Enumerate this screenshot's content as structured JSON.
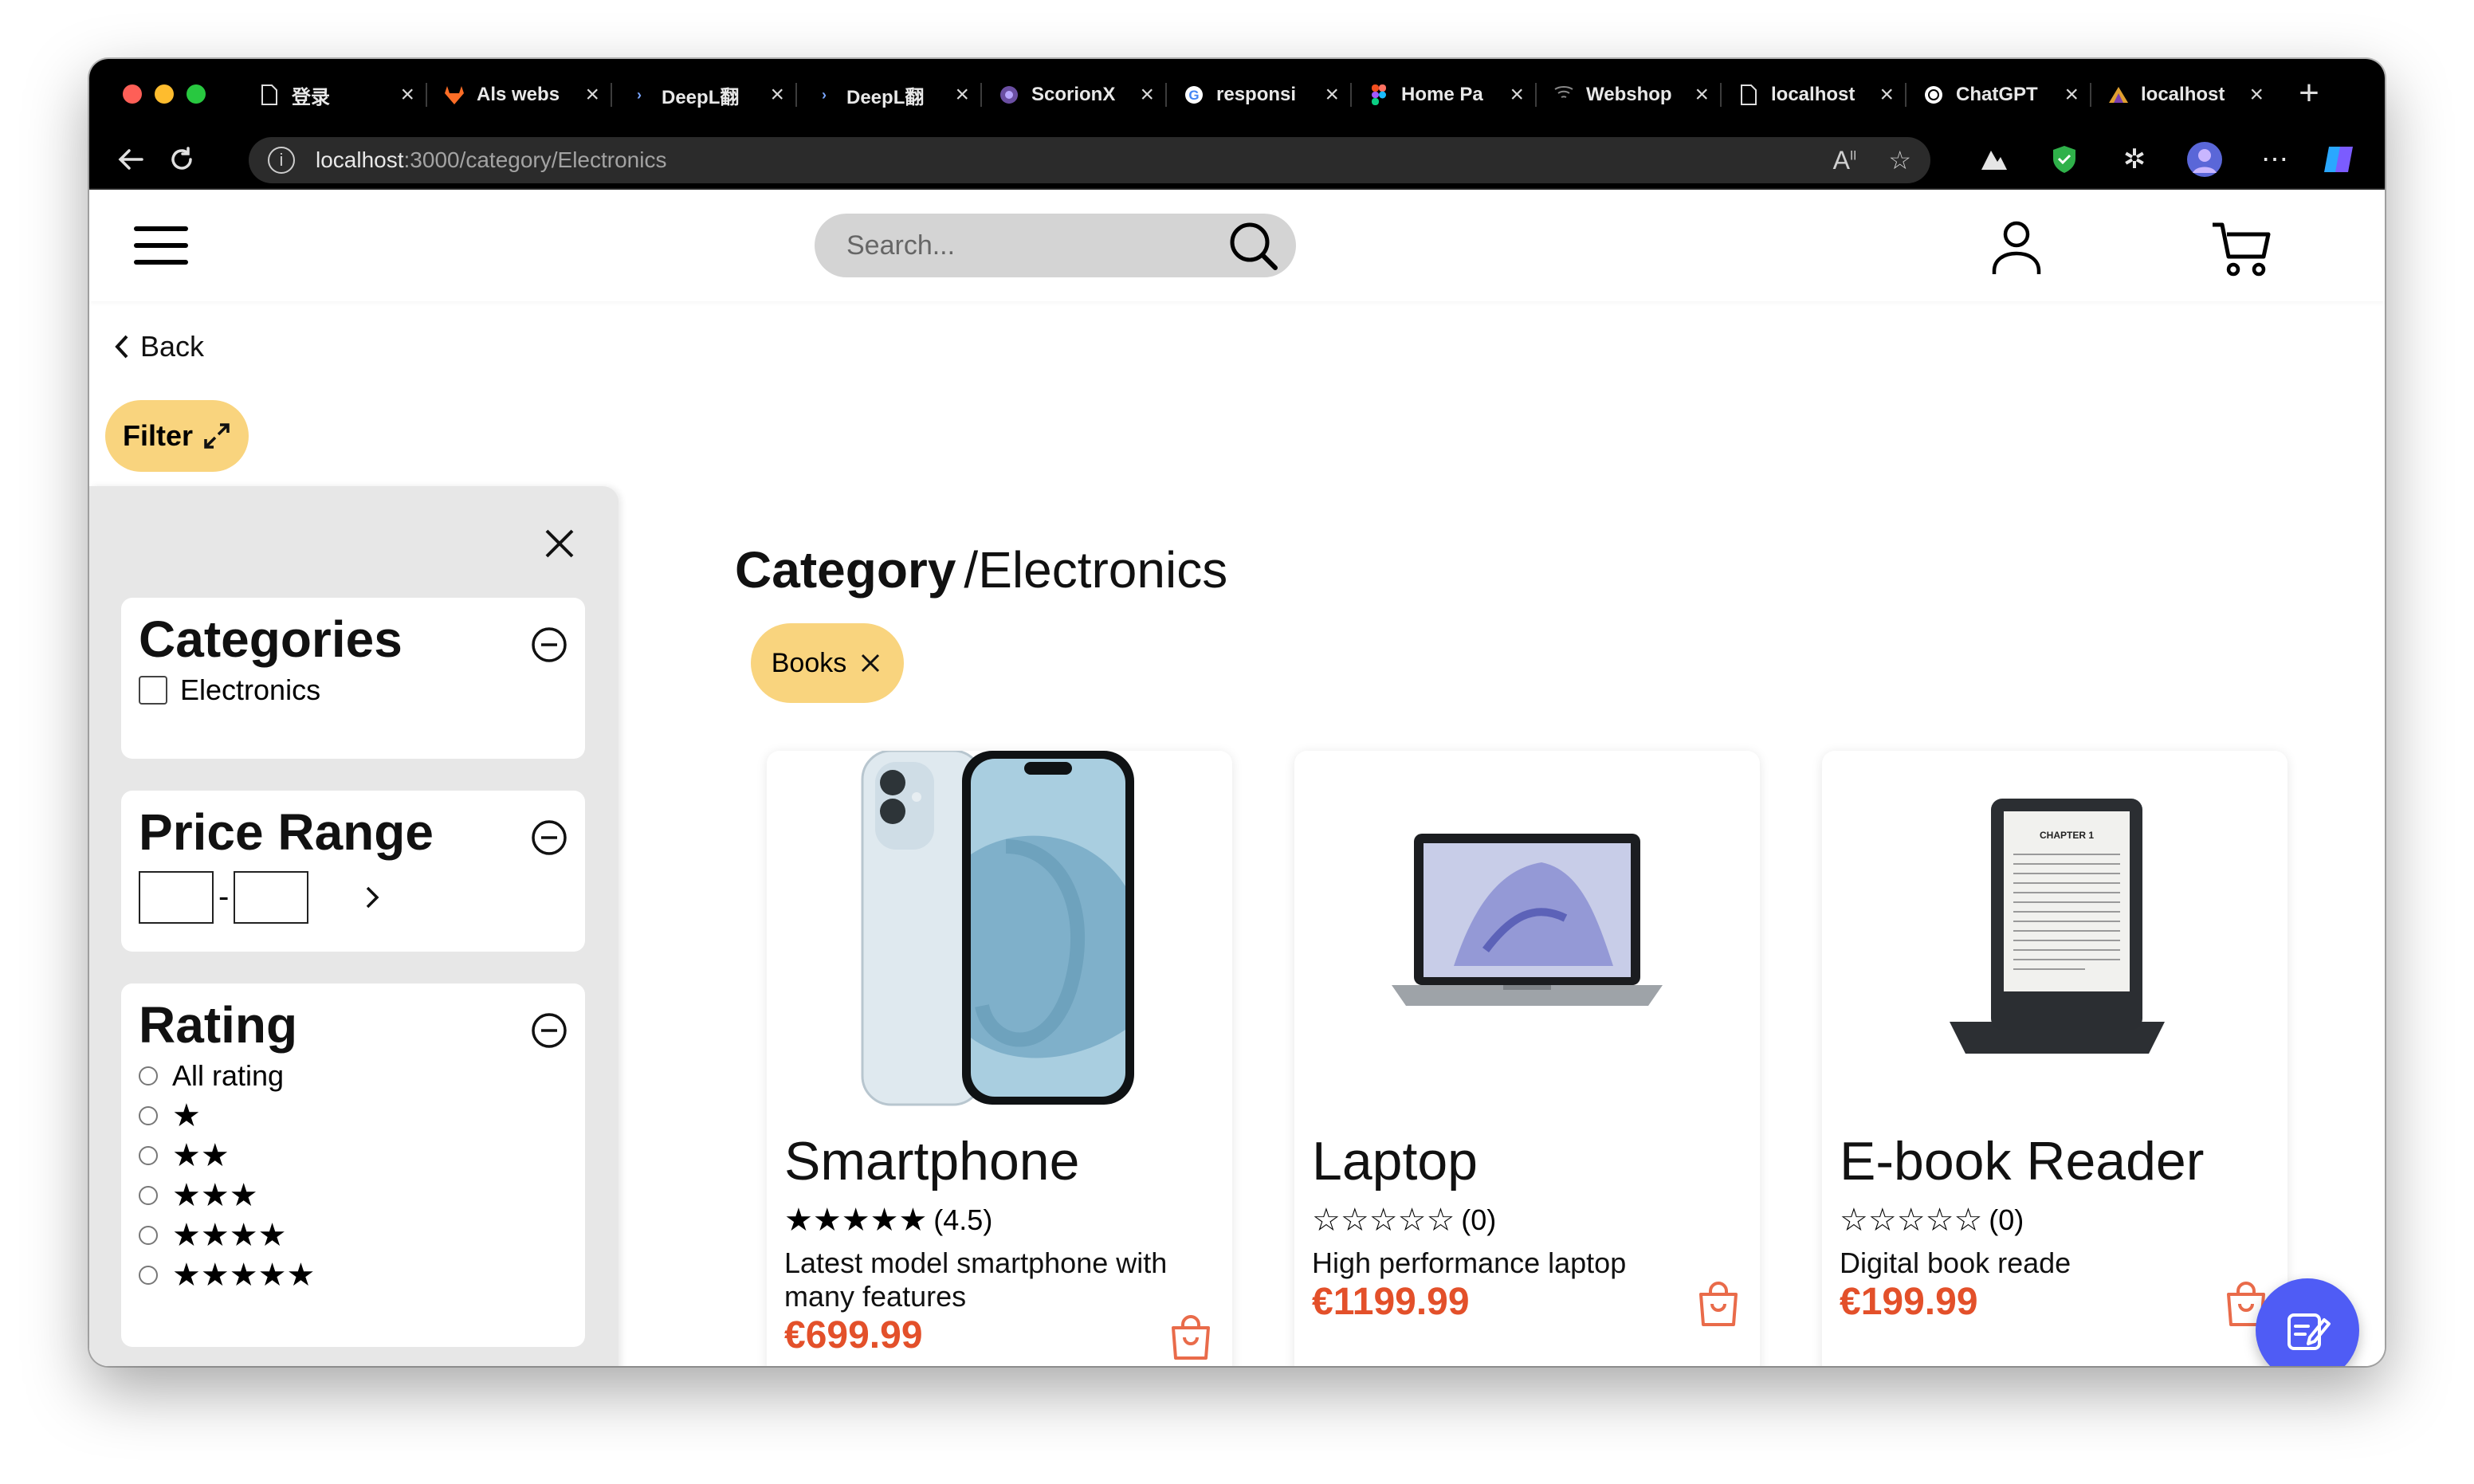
{
  "browser": {
    "tabs": [
      {
        "title": "登录",
        "favicon": "document-icon"
      },
      {
        "title": "Als webs",
        "favicon": "gitlab-icon"
      },
      {
        "title": "DeepL翻",
        "favicon": "deepl-icon"
      },
      {
        "title": "DeepL翻",
        "favicon": "deepl-icon"
      },
      {
        "title": "ScorionX",
        "favicon": "scorion-icon"
      },
      {
        "title": "responsi",
        "favicon": "google-icon"
      },
      {
        "title": "Home Pa",
        "favicon": "figma-icon"
      },
      {
        "title": "Webshop",
        "favicon": "webshop-icon"
      },
      {
        "title": "localhost",
        "favicon": "document-icon"
      },
      {
        "title": "ChatGPT",
        "favicon": "chatgpt-icon"
      },
      {
        "title": "localhost",
        "favicon": "app-icon"
      }
    ],
    "active_tab_index": 7,
    "url_host": "localhost",
    "url_path": ":3000/category/Electronics"
  },
  "header": {
    "search_placeholder": "Search..."
  },
  "nav": {
    "back_label": "Back",
    "filter_label": "Filter"
  },
  "filters": {
    "categories": {
      "title": "Categories",
      "options": [
        "Electronics"
      ]
    },
    "price_range": {
      "title": "Price Range",
      "separator": "-"
    },
    "rating": {
      "title": "Rating",
      "options": [
        "All rating",
        "★",
        "★★",
        "★★★",
        "★★★★",
        "★★★★★"
      ]
    }
  },
  "main": {
    "heading_bold": "Category",
    "heading_rest": "/Electronics",
    "active_chip": "Books"
  },
  "products": [
    {
      "name": "Smartphone",
      "stars": "★★★★★",
      "rating_text": "(4.5)",
      "description": "Latest model smartphone with many features",
      "price": "€699.99"
    },
    {
      "name": "Laptop",
      "stars": "☆☆☆☆☆",
      "rating_text": "(0)",
      "description": "High performance laptop",
      "price": "€1199.99"
    },
    {
      "name": "E-book Reader",
      "stars": "☆☆☆☆☆",
      "rating_text": "(0)",
      "description": "Digital book reade",
      "price": "€199.99"
    }
  ],
  "colors": {
    "accent_yellow": "#f9d47e",
    "price_red": "#e3502a",
    "fab_blue": "#4f5cf5"
  }
}
